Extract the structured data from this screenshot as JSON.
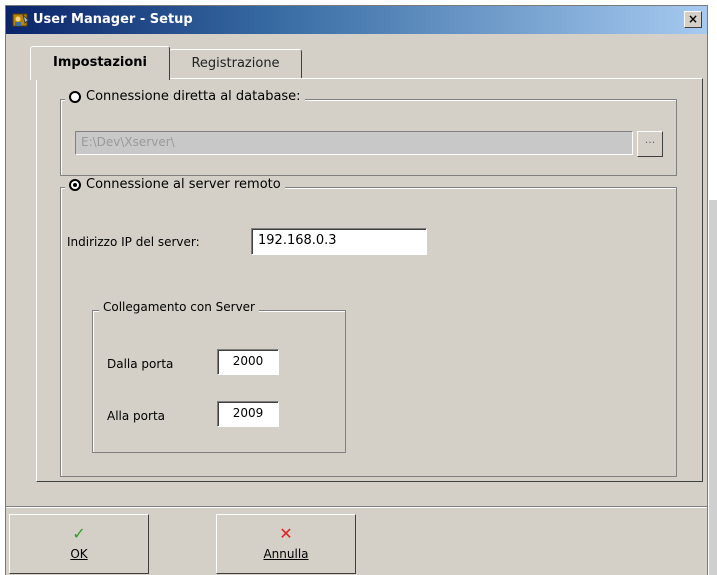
{
  "window": {
    "title": "User Manager - Setup",
    "close_glyph": "×",
    "app_icon": "user-manager-icon"
  },
  "tabs": [
    {
      "label": "Impostazioni",
      "active": true
    },
    {
      "label": "Registrazione",
      "active": false
    }
  ],
  "database": {
    "option_label": "Connessione diretta al database:",
    "selected": false,
    "path_value": "E:\\Dev\\Xserver\\",
    "browse_label": "..."
  },
  "remote": {
    "option_label": "Connessione al server remoto",
    "selected": true,
    "ip_label": "Indirizzo IP del server:",
    "ip_value": "192.168.0.3",
    "server_group": {
      "title": "Collegamento con Server",
      "from_port_label": "Dalla porta",
      "from_port_value": "2000",
      "to_port_label": "Alla porta",
      "to_port_value": "2009"
    }
  },
  "buttons": {
    "ok": {
      "icon": "checkmark-icon",
      "glyph": "✓",
      "label": "OK",
      "color": "#2aa02a"
    },
    "cancel": {
      "icon": "cross-icon",
      "glyph": "✕",
      "label": "Annulla",
      "color": "#e02020"
    }
  }
}
